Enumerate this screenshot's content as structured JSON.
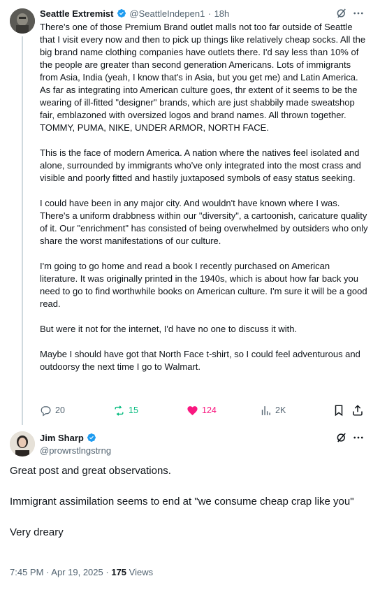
{
  "tweet": {
    "name": "Seattle Extremist",
    "handle": "@SeattleIndepen1",
    "separator": "·",
    "time": "18h",
    "paragraphs": [
      "There's one of those Premium Brand outlet malls not too far outside of Seattle that I visit every now and then to pick up things like relatively cheap socks.  All the big brand name clothing companies have outlets there.   I'd say less than 10% of the people are greater than second generation Americans.   Lots of immigrants from Asia, India (yeah, I know that's in Asia, but you get me) and Latin America.   As far as integrating into American culture goes, thr extent of it seems to be the wearing of ill-fitted \"designer\" brands, which are just shabbily made sweatshop fair, emblazoned with oversized logos and brand names.  All thrown together.  TOMMY, PUMA, NIKE, UNDER ARMOR, NORTH FACE.",
      "This is the face of modern America.  A nation where the natives feel isolated and alone, surrounded by immigrants who've only integrated into the most crass and visible and poorly fitted and hastily juxtaposed symbols of easy status seeking.",
      "I could have been in any major city.  And wouldn't have known where I was.  There's a uniform drabbness within our \"diversity\", a cartoonish, caricature quality of it.  Our \"enrichment\" has consisted of being overwhelmed by outsiders who only share the worst manifestations of our culture.",
      "I'm going to go home and read a book I recently purchased on American literature.   It was originally printed in the 1940s, which is about how far back you need to go to find worthwhile books on American culture.   I'm sure it will be a good read.",
      "But were it not for the internet, I'd have no one to discuss it with.",
      "Maybe I should have got that North Face t-shirt, so I could feel adventurous and outdoorsy the next time I go to Walmart."
    ],
    "stats": {
      "replies": "20",
      "retweets": "15",
      "likes": "124",
      "views": "2K"
    }
  },
  "reply": {
    "name": "Jim Sharp",
    "handle": "@prowrstlngstrng",
    "paragraphs": [
      "Great post and great observations.",
      "Immigrant assimilation seems to end at \"we consume cheap crap like you\"",
      "Very dreary"
    ],
    "time": "7:45 PM",
    "separator1": "·",
    "date": "Apr 19, 2025",
    "separator2": "·",
    "views_count": "175",
    "views_label": "Views"
  },
  "colors": {
    "verified": "#1d9bf0",
    "retweet_active": "#00ba7c",
    "like_active": "#f91880",
    "secondary_text": "#536471"
  },
  "icons": [
    "verified-badge-icon",
    "grok-icon",
    "more-icon",
    "reply-icon",
    "retweet-icon",
    "like-icon",
    "views-icon",
    "bookmark-icon",
    "share-icon"
  ]
}
